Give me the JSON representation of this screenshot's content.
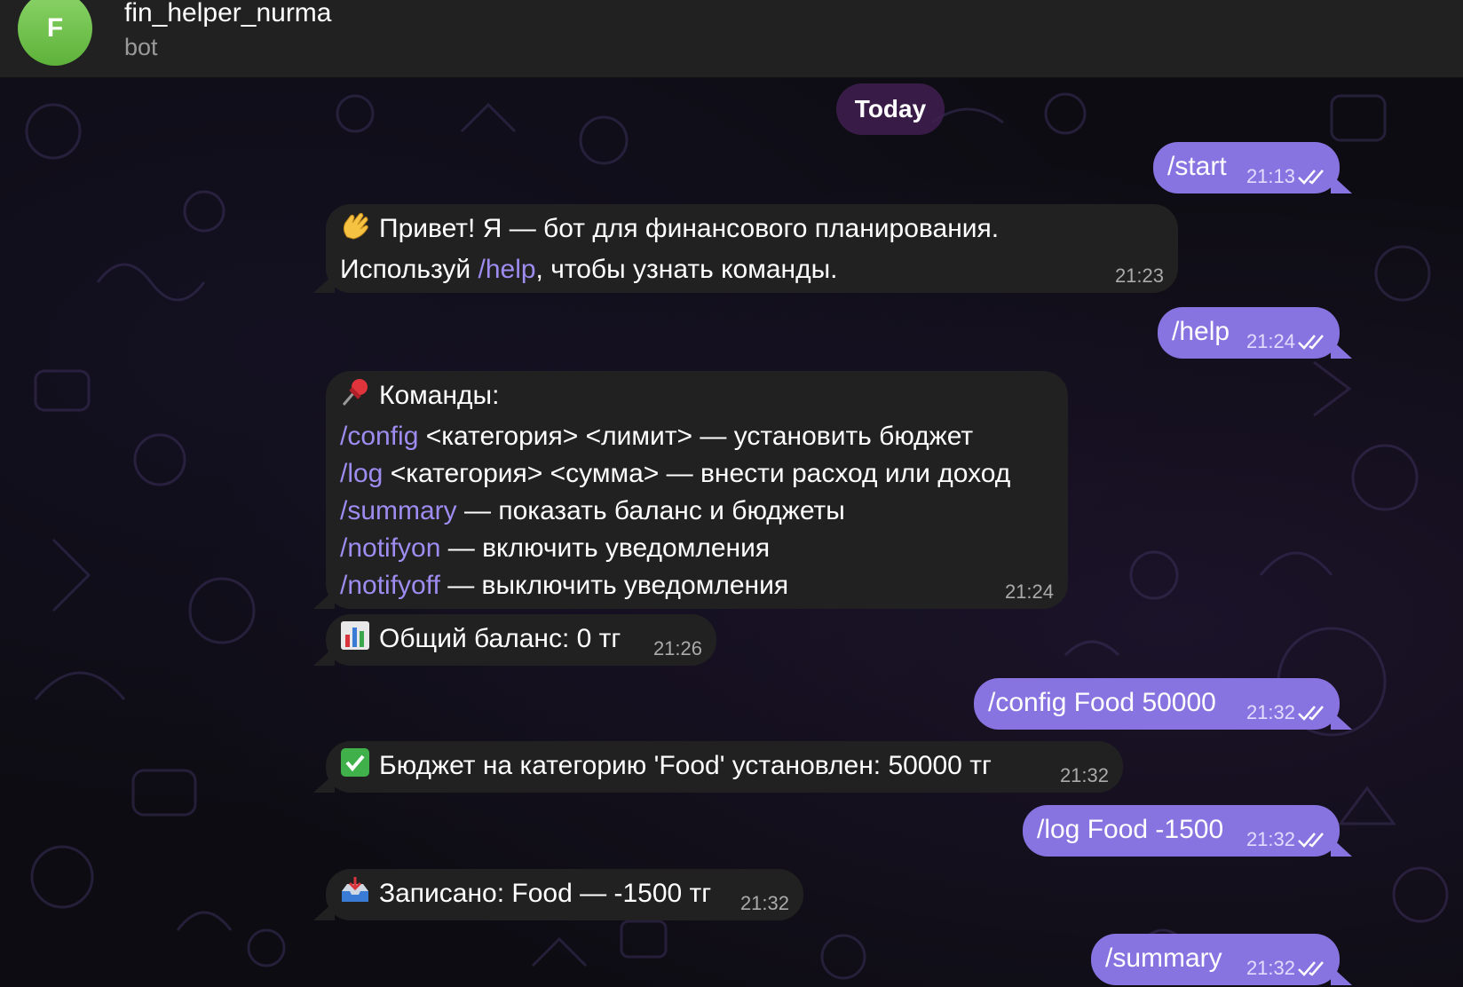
{
  "header": {
    "avatar_letter": "F",
    "title": "fin_helper_nurma",
    "subtitle": "bot"
  },
  "date_separator": "Today",
  "messages": [
    {
      "dir": "out",
      "text": "/start",
      "time": "21:13"
    },
    {
      "dir": "in",
      "lines": [
        {
          "emoji": "waving-hand",
          "pre": "Привет! Я — бот для финансового планирования."
        },
        {
          "pre": "Используй ",
          "cmd": "/help",
          "post": ", чтобы узнать команды."
        }
      ],
      "time": "21:23"
    },
    {
      "dir": "out",
      "text": "/help",
      "time": "21:24"
    },
    {
      "dir": "in",
      "lines": [
        {
          "emoji": "pushpin",
          "pre": "Команды:"
        },
        {
          "cmd": "/config",
          "post": " <категория> <лимит> — установить бюджет"
        },
        {
          "cmd": "/log",
          "post": " <категория> <сумма> — внести расход или доход"
        },
        {
          "cmd": "/summary",
          "post": " — показать баланс и бюджеты"
        },
        {
          "cmd": "/notifyon",
          "post": " — включить уведомления"
        },
        {
          "cmd": "/notifyoff",
          "post": " — выключить уведомления"
        }
      ],
      "time": "21:24"
    },
    {
      "dir": "in",
      "lines": [
        {
          "emoji": "bar-chart",
          "pre": "Общий баланс: 0 тг"
        }
      ],
      "time": "21:26"
    },
    {
      "dir": "out",
      "text": "/config Food 50000",
      "time": "21:32"
    },
    {
      "dir": "in",
      "lines": [
        {
          "emoji": "check-mark-button",
          "pre": "Бюджет на категорию 'Food' установлен: 50000 тг"
        }
      ],
      "time": "21:32"
    },
    {
      "dir": "out",
      "text": "/log Food -1500",
      "time": "21:32"
    },
    {
      "dir": "in",
      "lines": [
        {
          "emoji": "inbox-tray",
          "pre": "Записано: Food — -1500 тг"
        }
      ],
      "time": "21:32"
    },
    {
      "dir": "out",
      "text": "/summary",
      "time": "21:32"
    }
  ],
  "colors": {
    "outgoing_bubble": "#8774e1",
    "incoming_bubble": "#212121",
    "command_link": "#9e8cf0",
    "header_bg": "#212121"
  }
}
